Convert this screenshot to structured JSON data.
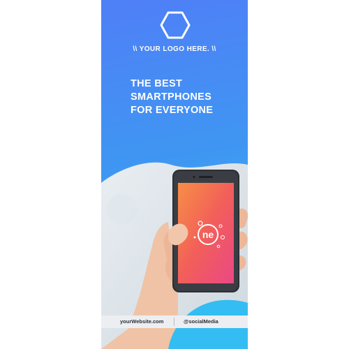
{
  "banner": {
    "logo_icon": "hexagon-outline-icon",
    "logo_text": "\\\\ YOUR LOGO HERE. \\\\",
    "headline": [
      "THE BEST",
      "SMARTPHONES",
      "FOR EVERYONE"
    ],
    "phone_screen_logo": "ne",
    "website": "yourWebsite.com",
    "social": "@socialMedia",
    "colors": {
      "gradient_top": "#4f7ff7",
      "gradient_bottom": "#33c0ef",
      "screen_orange": "#f26a3b",
      "screen_pink": "#ec3f78"
    }
  }
}
